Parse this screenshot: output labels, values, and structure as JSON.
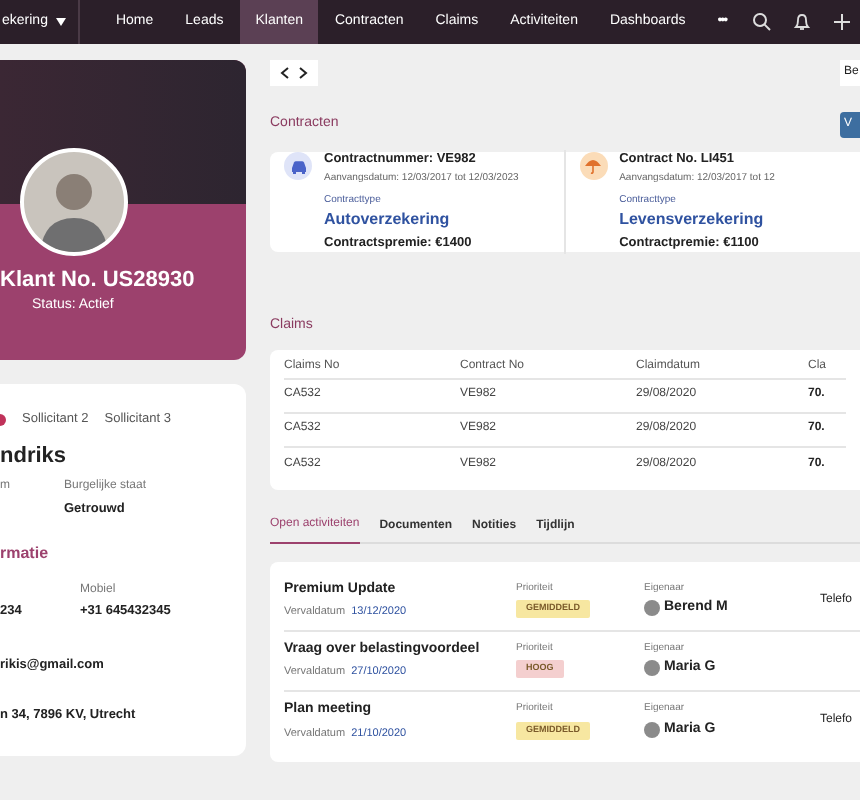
{
  "nav": {
    "app_menu": "ekering",
    "items": [
      {
        "label": "Home",
        "selected": false
      },
      {
        "label": "Leads",
        "selected": false
      },
      {
        "label": "Klanten",
        "selected": true
      },
      {
        "label": "Contracten",
        "selected": false
      },
      {
        "label": "Claims",
        "selected": false
      },
      {
        "label": "Activiteiten",
        "selected": false
      },
      {
        "label": "Dashboards",
        "selected": false
      }
    ],
    "more": "•••"
  },
  "profile": {
    "title": "Klant No. US28930",
    "status": "Status: Actief"
  },
  "applicant": {
    "tabs": [
      {
        "selected": true
      },
      {
        "label": "Sollicitant 2",
        "selected": false
      },
      {
        "label": "Sollicitant 3",
        "selected": false
      }
    ],
    "name": "ndriks",
    "fields": [
      {
        "label": "m"
      },
      {
        "label": "Burgelijke staat",
        "value": "Getrouwd"
      }
    ],
    "section": "rmatie",
    "contact": [
      {
        "value": "234"
      },
      {
        "label": "Mobiel",
        "value": "+31 645432345"
      }
    ],
    "email": "rikis@gmail.com",
    "address": "n 34, 7896 KV, Utrecht"
  },
  "toolbar": {
    "button": "Be"
  },
  "contracts": {
    "heading": "Contracten",
    "button": "V",
    "items": [
      {
        "kind": "car",
        "number": "Contractnummer: VE982",
        "dates": "Aanvangsdatum: 12/03/2017 tot 12/03/2023",
        "type_label": "Contracttype",
        "type": "Autoverzekering",
        "premium": "Contractspremie: €1400"
      },
      {
        "kind": "umbrella",
        "number": "Contract No. LI451",
        "dates": "Aanvangsdatum: 12/03/2017 tot 12",
        "type_label": "Contracttype",
        "type": "Levensverzekering",
        "premium": "Contractpremie: €1100"
      }
    ]
  },
  "claims": {
    "heading": "Claims",
    "columns": [
      "Claims No",
      "Contract No",
      "Claimdatum",
      "Cla"
    ],
    "rows": [
      [
        "CA532",
        "VE982",
        "29/08/2020",
        "70."
      ],
      [
        "CA532",
        "VE982",
        "29/08/2020",
        "70."
      ],
      [
        "CA532",
        "VE982",
        "29/08/2020",
        "70."
      ]
    ]
  },
  "tabs": [
    {
      "label": "Open activiteiten",
      "selected": true
    },
    {
      "label": "Documenten",
      "selected": false
    },
    {
      "label": "Notities",
      "selected": false
    },
    {
      "label": "Tijdlijn",
      "selected": false
    }
  ],
  "activities": [
    {
      "title": "Premium Update",
      "due_label": "Vervaldatum",
      "due": "13/12/2020",
      "priority_label": "Prioriteit",
      "priority": "GEMIDDELD",
      "color": "#f7e7a1",
      "owner_label": "Eigenaar",
      "owner": "Berend M",
      "column_5": "Telefo"
    },
    {
      "title": "Vraag over belastingvoordeel",
      "due_label": "Vervaldatum",
      "due": "27/10/2020",
      "priority_label": "Prioriteit",
      "priority": "HOOG",
      "color": "#f4cfcf",
      "owner_label": "Eigenaar",
      "owner": "Maria G"
    },
    {
      "title": "Plan meeting",
      "due_label": "Vervaldatum",
      "due": "21/10/2020",
      "priority_label": "Prioriteit",
      "priority": "GEMIDDELD",
      "color": "#f7e7a1",
      "owner_label": "Eigenaar",
      "owner": "Maria G",
      "column_5": "Telefo"
    }
  ]
}
